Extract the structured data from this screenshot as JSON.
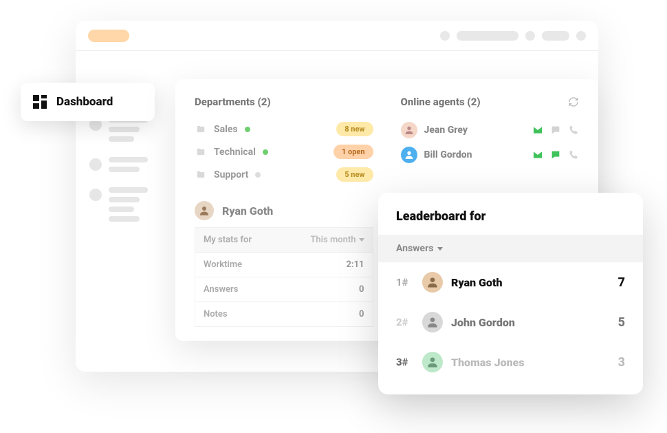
{
  "nav": {
    "dashboard": "Dashboard"
  },
  "departments": {
    "title": "Departments (2)",
    "items": [
      {
        "name": "Sales",
        "status": "online",
        "badge": "8 new",
        "badgeClass": "badge-yellow"
      },
      {
        "name": "Technical",
        "status": "online",
        "badge": "1 open",
        "badgeClass": "badge-orange"
      },
      {
        "name": "Support",
        "status": "off",
        "badge": "5 new",
        "badgeClass": "badge-yellow"
      }
    ]
  },
  "agents": {
    "title": "Online agents (2)",
    "items": [
      {
        "name": "Jean Grey",
        "mail": true,
        "chat": false,
        "call": false,
        "avatarBg": "#f4d7c7"
      },
      {
        "name": "Bill Gordon",
        "mail": true,
        "chat": true,
        "call": false,
        "avatarBg": "#4fb0f0"
      }
    ]
  },
  "profile": {
    "name": "Ryan Goth",
    "stats": {
      "header_label": "My stats for",
      "period": "This month",
      "rows": [
        {
          "label": "Worktime",
          "value": "2:11"
        },
        {
          "label": "Answers",
          "value": "0"
        },
        {
          "label": "Notes",
          "value": "0"
        }
      ]
    }
  },
  "leaderboard": {
    "title": "Leaderboard for",
    "metric": "Answers",
    "rows": [
      {
        "rank": "1#",
        "name": "Ryan Goth",
        "score": "7",
        "avatarBg": "#e8c9a8"
      },
      {
        "rank": "2#",
        "name": "John Gordon",
        "score": "5",
        "avatarBg": "#d8d8d8"
      },
      {
        "rank": "3#",
        "name": "Thomas Jones",
        "score": "3",
        "avatarBg": "#bde8c9"
      }
    ]
  }
}
